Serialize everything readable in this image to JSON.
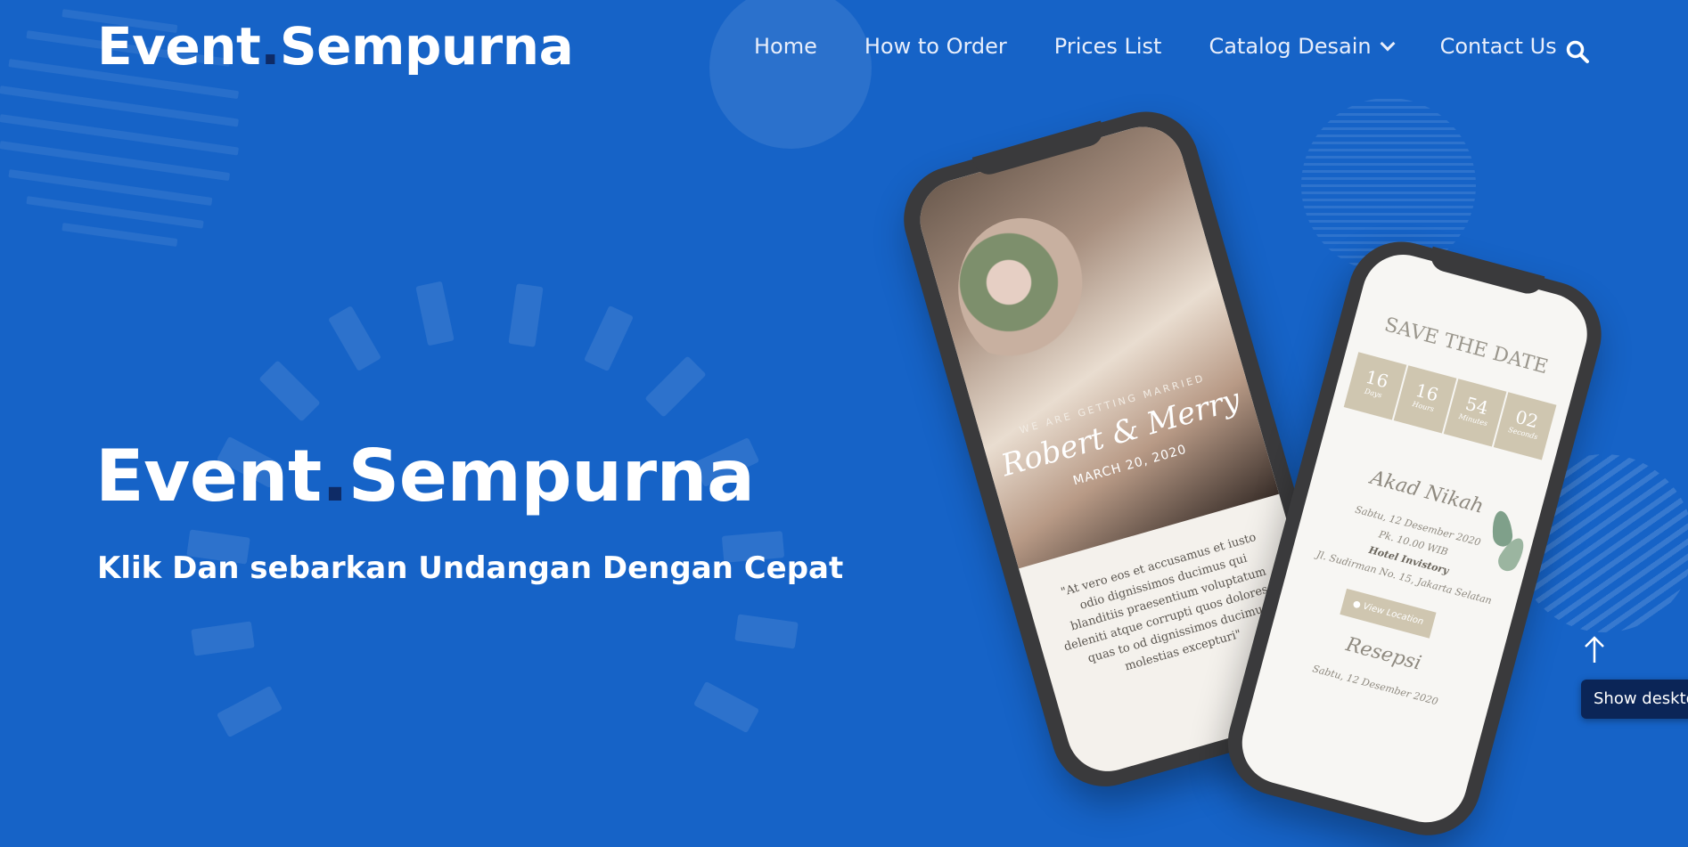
{
  "header": {
    "logo": {
      "part1": "Event",
      "dot": ".",
      "part2": "Sempurna"
    },
    "nav": [
      {
        "label": "Home"
      },
      {
        "label": "How to Order"
      },
      {
        "label": "Prices List"
      },
      {
        "label": "Catalog Desain",
        "icon": "chevron-down-icon"
      },
      {
        "label": "Contact Us"
      }
    ],
    "search_icon": "search-icon"
  },
  "hero": {
    "title": {
      "part1": "Event",
      "dot": ".",
      "part2": "Sempurna"
    },
    "subtitle": "Klik Dan sebarkan Undangan Dengan Cepat"
  },
  "phone_left": {
    "kicker": "WE ARE GETTING MARRIED",
    "names": "Robert & Merry",
    "date": "MARCH 20, 2020",
    "quote": "\"At vero eos et accusamus et iusto odio dignissimos ducimus qui blanditiis praesentium voluptatum deleniti atque corrupti quos dolores et quas to od dignissimos ducimus molestias excepturi\""
  },
  "phone_right": {
    "save_the_date": "SAVE THE DATE",
    "countdown": [
      {
        "value": "16",
        "unit": "Days"
      },
      {
        "value": "16",
        "unit": "Hours"
      },
      {
        "value": "54",
        "unit": "Minutes"
      },
      {
        "value": "02",
        "unit": "Seconds"
      }
    ],
    "akad_title": "Akad Nikah",
    "akad_date": "Sabtu, 12 Desember 2020",
    "akad_time": "Pk. 10.00 WIB",
    "akad_venue": "Hotel Invistory",
    "akad_address": "Jl. Sudirman No. 15, Jakarta Selatan",
    "location_button": "View Location",
    "resepsi_title": "Resepsi",
    "resepsi_date": "Sabtu, 12 Desember 2020"
  },
  "floating": {
    "scroll_top_icon": "arrow-up-icon",
    "show_desktop": "Show desktop"
  },
  "colors": {
    "background": "#1663c7",
    "logo_dot": "#0e2b66",
    "show_desktop_bg": "#0b2557",
    "card_accent": "#cfc6b0"
  }
}
